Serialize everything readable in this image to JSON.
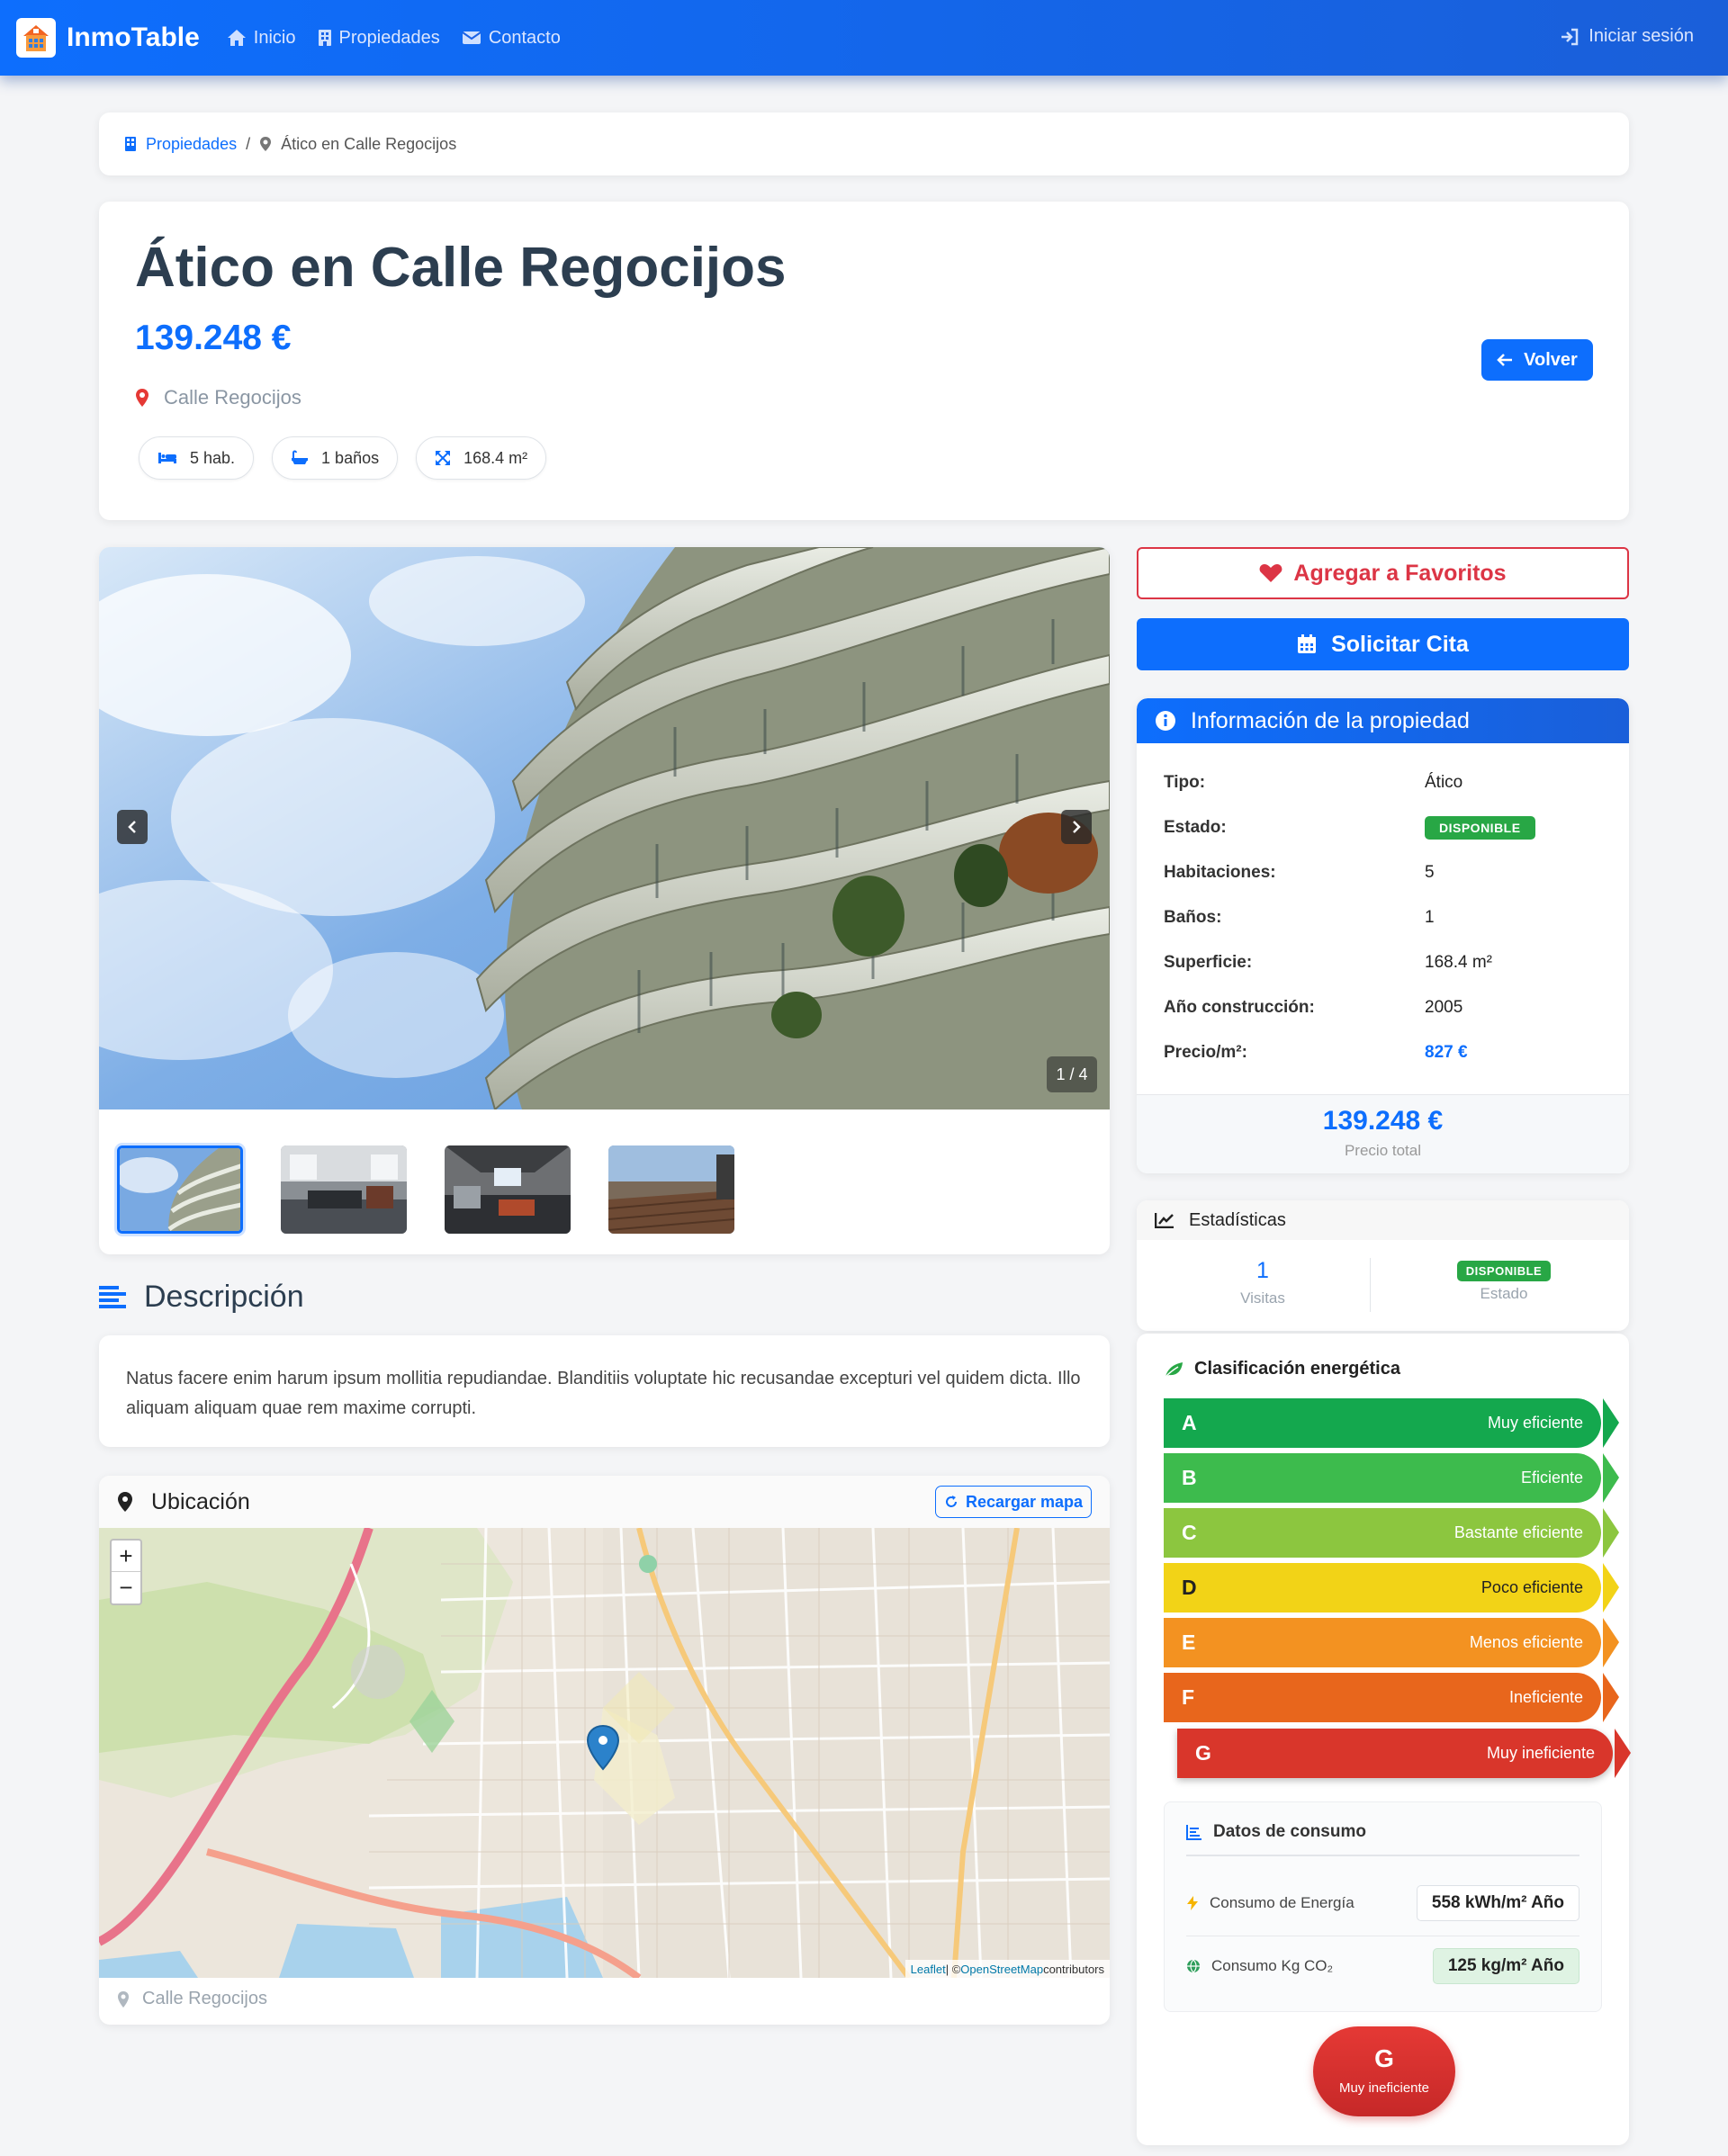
{
  "navbar": {
    "brand": "InmoTable",
    "links": [
      "Inicio",
      "Propiedades",
      "Contacto"
    ],
    "login": "Iniciar sesión"
  },
  "breadcrumb": {
    "root": "Propiedades",
    "separator": "/",
    "current": "Ático en Calle Regocijos"
  },
  "property": {
    "title": "Ático en Calle Regocijos",
    "price": "139.248 €",
    "address": "Calle Regocijos",
    "chips": [
      "5 hab.",
      "1 baños",
      "168.4 m²"
    ],
    "back_button": "Volver"
  },
  "gallery": {
    "counter": "1 / 4",
    "thumbnail_count": 4,
    "active_index": 0
  },
  "description": {
    "title": "Descripción",
    "text": "Natus facere enim harum ipsum mollitia repudiandae. Blanditiis voluptate hic recusandae excepturi vel quidem dicta. Illo aliquam aliquam quae rem maxime corrupti."
  },
  "location": {
    "title": "Ubicación",
    "reload_button": "Recargar mapa",
    "zoom_in": "+",
    "zoom_out": "−",
    "attribution": {
      "leaflet": "Leaflet",
      "sep": " | © ",
      "osm": "OpenStreetMap",
      "contributors": " contributors"
    },
    "address": "Calle Regocijos"
  },
  "actions": {
    "favorite": "Agregar a Favoritos",
    "appointment": "Solicitar Cita"
  },
  "info": {
    "title": "Información de la propiedad",
    "rows": [
      {
        "label": "Tipo:",
        "value": "Ático"
      },
      {
        "label": "Estado:",
        "value": "DISPONIBLE"
      },
      {
        "label": "Habitaciones:",
        "value": "5"
      },
      {
        "label": "Baños:",
        "value": "1"
      },
      {
        "label": "Superficie:",
        "value": "168.4 m²"
      },
      {
        "label": "Año construcción:",
        "value": "2005"
      },
      {
        "label": "Precio/m²:",
        "value": "827 €"
      }
    ],
    "total_price": "139.248 €",
    "total_label": "Precio total"
  },
  "stats": {
    "title": "Estadísticas",
    "visits_value": "1",
    "visits_label": "Visitas",
    "status_value": "DISPONIBLE",
    "status_label": "Estado"
  },
  "energy": {
    "title": "Clasificación energética",
    "ratings": [
      {
        "letter": "A",
        "label": "Muy eficiente",
        "color": "#14a84e"
      },
      {
        "letter": "B",
        "label": "Eficiente",
        "color": "#3dbb4d"
      },
      {
        "letter": "C",
        "label": "Bastante eficiente",
        "color": "#8cc63f"
      },
      {
        "letter": "D",
        "label": "Poco eficiente",
        "color": "#f2d317"
      },
      {
        "letter": "E",
        "label": "Menos eficiente",
        "color": "#f39221"
      },
      {
        "letter": "F",
        "label": "Ineficiente",
        "color": "#e8661c"
      },
      {
        "letter": "G",
        "label": "Muy ineficiente",
        "color": "#d9362b"
      }
    ],
    "active_rating": "G",
    "consumption": {
      "title": "Datos de consumo",
      "energy_label": "Consumo de Energía",
      "energy_value": "558 kWh/m² Año",
      "co2_label": "Consumo Kg CO₂",
      "co2_value": "125 kg/m² Año"
    },
    "badge_letter": "G",
    "badge_text": "Muy ineficiente"
  },
  "colors": {
    "primary": "#0d6efd",
    "danger": "#dc3545",
    "success": "#28a745"
  }
}
